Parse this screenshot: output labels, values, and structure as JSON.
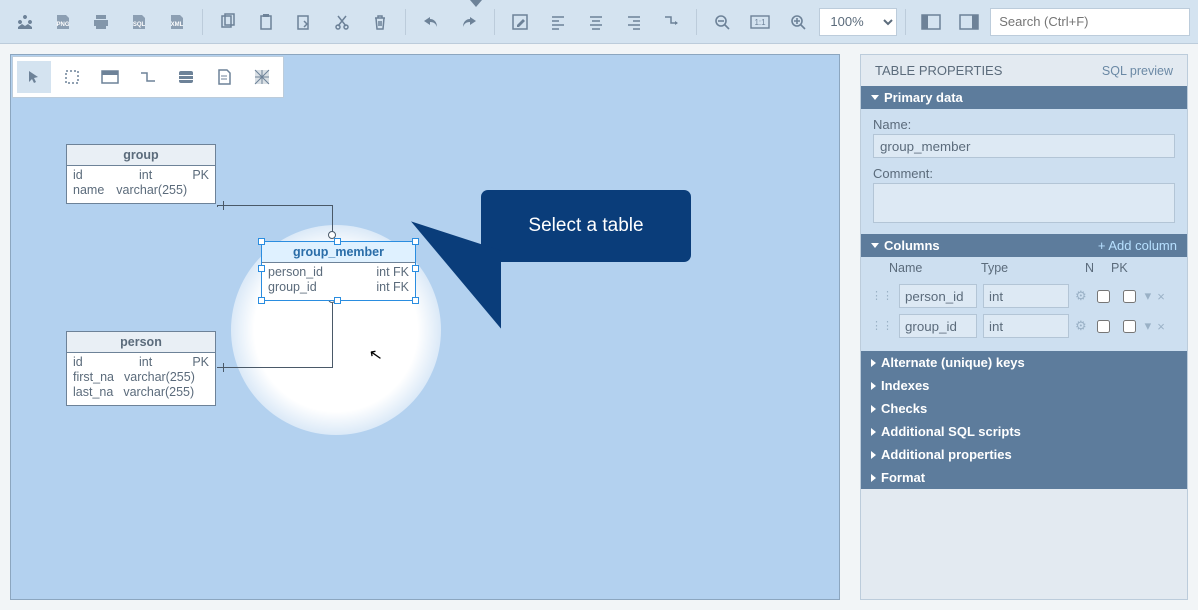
{
  "toolbar": {
    "zoom_value": "100%",
    "search_placeholder": "Search (Ctrl+F)"
  },
  "callout": {
    "text": "Select a table"
  },
  "erd": {
    "group": {
      "title": "group",
      "c1_name": "id",
      "c1_type": "int",
      "c1_key": "PK",
      "c2_name": "name",
      "c2_type": "varchar(255)",
      "c2_key": ""
    },
    "group_member": {
      "title": "group_member",
      "c1_name": "person_id",
      "c1_type": "int FK",
      "c2_name": "group_id",
      "c2_type": "int FK"
    },
    "person": {
      "title": "person",
      "c1_name": "id",
      "c1_type": "int",
      "c1_key": "PK",
      "c2_name": "first_na",
      "c2_type": "varchar(255)",
      "c2_key": "",
      "c3_name": "last_na",
      "c3_type": "varchar(255)",
      "c3_key": ""
    }
  },
  "side": {
    "title": "TABLE PROPERTIES",
    "sql_preview": "SQL preview",
    "primary_data": {
      "header": "Primary data",
      "name_label": "Name:",
      "name_value": "group_member",
      "comment_label": "Comment:",
      "comment_value": ""
    },
    "columns": {
      "header": "Columns",
      "add_link": "+ Add column",
      "head_name": "Name",
      "head_type": "Type",
      "head_n": "N",
      "head_pk": "PK",
      "rows": [
        {
          "name": "person_id",
          "type": "int"
        },
        {
          "name": "group_id",
          "type": "int"
        }
      ]
    },
    "sections": {
      "alt_keys": "Alternate (unique) keys",
      "indexes": "Indexes",
      "checks": "Checks",
      "sql_scripts": "Additional SQL scripts",
      "add_props": "Additional properties",
      "format": "Format"
    }
  }
}
